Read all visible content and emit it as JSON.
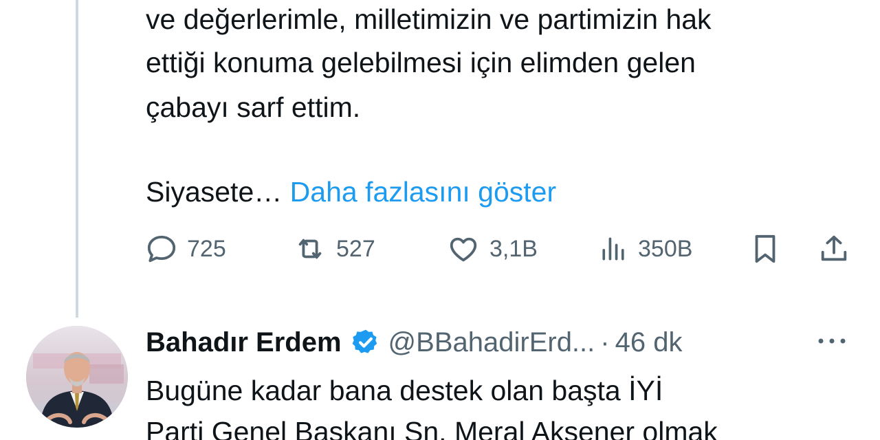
{
  "tweet1": {
    "lines": [
      "ve değerlerimle, milletimizin ve partimizin hak",
      "ettiği konuma gelebilmesi için elimden gelen",
      "çabayı sarf ettim."
    ],
    "truncated_text": "Siyasete…",
    "show_more_label": "Daha fazlasını göster",
    "actions": {
      "replies": "725",
      "retweets": "527",
      "likes": "3,1B",
      "views": "350B"
    }
  },
  "tweet2": {
    "author_name": "Bahadır Erdem",
    "handle": "@BBahadirErd...",
    "separator": "·",
    "time": "46 dk",
    "lines": [
      "Bugüne kadar bana destek olan başta İYİ",
      "Parti Genel Başkanı Sn. Meral Akşener olmak"
    ]
  },
  "colors": {
    "link": "#1d9bf0",
    "secondary_text": "#536471",
    "primary_text": "#0f1419",
    "verified_badge": "#1d9bf0",
    "thread_line": "#cfd9de"
  },
  "icons": {
    "reply": "speech-bubble-icon",
    "retweet": "retweet-arrows-icon",
    "like": "heart-icon",
    "views": "bar-chart-icon",
    "bookmark": "bookmark-icon",
    "share": "share-upload-icon",
    "verified": "verified-badge-icon",
    "more": "more-dots-icon"
  }
}
